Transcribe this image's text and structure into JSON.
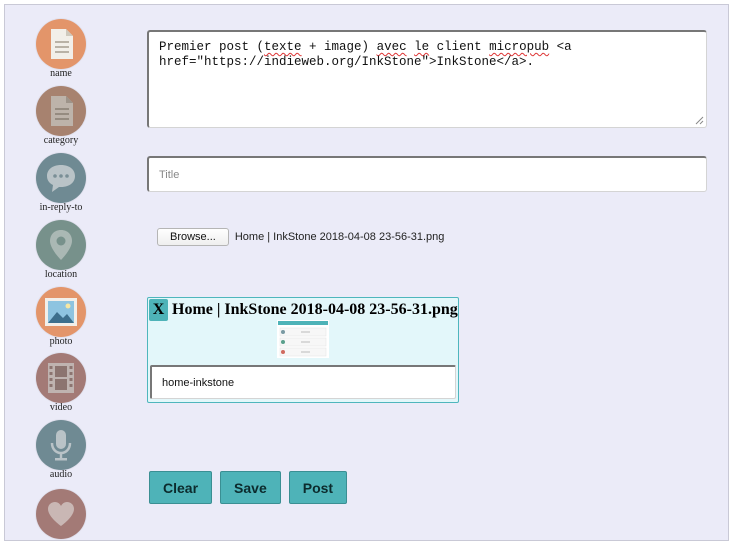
{
  "sidebar": {
    "items": [
      {
        "label": "name",
        "icon": "document-icon",
        "color": "#e3956a"
      },
      {
        "label": "category",
        "icon": "document-icon",
        "color": "#a7826f"
      },
      {
        "label": "in-reply-to",
        "icon": "chat-bubble-icon",
        "color": "#6f8a93"
      },
      {
        "label": "location",
        "icon": "map-pin-icon",
        "color": "#77918b"
      },
      {
        "label": "photo",
        "icon": "image-icon",
        "color": "#e3956a"
      },
      {
        "label": "video",
        "icon": "film-icon",
        "color": "#a37a76"
      },
      {
        "label": "audio",
        "icon": "microphone-icon",
        "color": "#6f8a93"
      },
      {
        "label": "",
        "icon": "heart-icon",
        "color": "#a37a76"
      }
    ]
  },
  "content": {
    "text": "Premier post (texte + image) avec le client micropub <a href=\"https://indieweb.org/InkStone\">InkStone</a>.",
    "title_placeholder": "Title",
    "title_value": "",
    "browse_label": "Browse...",
    "selected_file": "Home | InkStone 2018-04-08 23-56-31.png",
    "media": {
      "remove_label": "X",
      "filename": "Home | InkStone 2018-04-08 23-56-31.png",
      "alt_value": "home-inkstone"
    },
    "buttons": {
      "clear": "Clear",
      "save": "Save",
      "post": "Post"
    }
  },
  "colors": {
    "accent": "#4eb3b8",
    "panel": "#ebebf8",
    "card": "#e3f7fa"
  }
}
